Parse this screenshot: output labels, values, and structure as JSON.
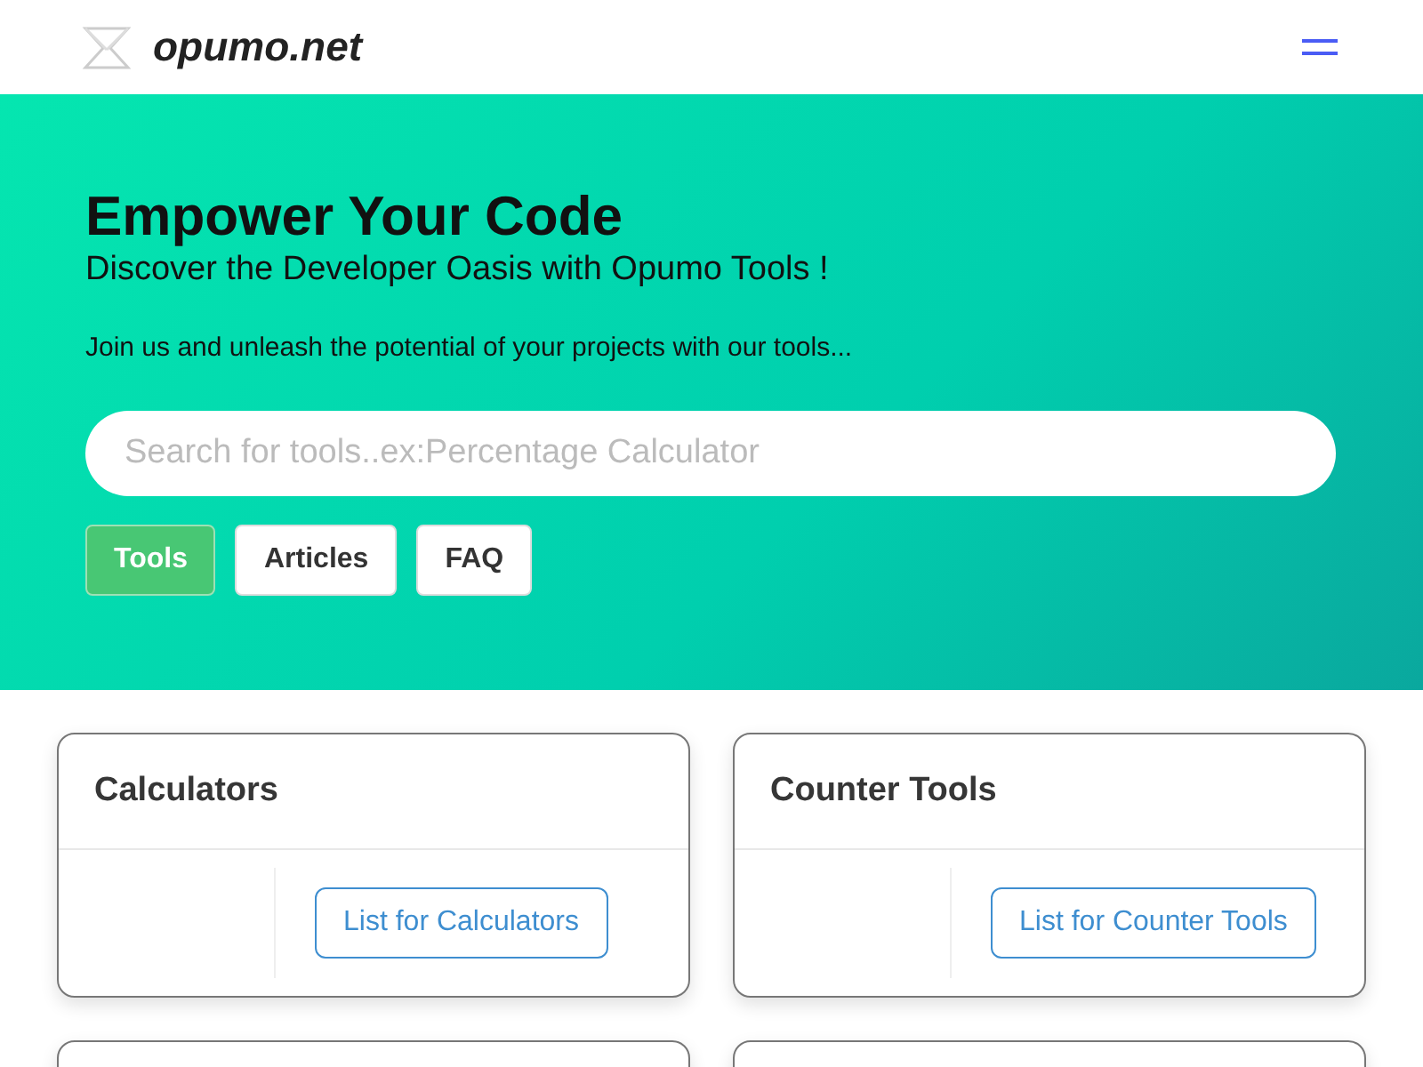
{
  "header": {
    "site_name": "opumo.net"
  },
  "hero": {
    "title": "Empower Your Code",
    "subtitle": "Discover the Developer Oasis with Opumo Tools !",
    "tagline": "Join us and unleash the potential of your projects with our tools...",
    "search": {
      "placeholder": "Search for tools..ex:Percentage Calculator"
    },
    "tabs": [
      {
        "label": "Tools",
        "selected": true
      },
      {
        "label": "Articles",
        "selected": false
      },
      {
        "label": "FAQ",
        "selected": false
      }
    ]
  },
  "cards": [
    {
      "title": "Calculators",
      "link": "List for Calculators"
    },
    {
      "title": "Counter Tools",
      "link": "List for Counter Tools"
    }
  ],
  "more_cards": [
    {
      "kind": "card"
    },
    {
      "kind": "card"
    }
  ]
}
